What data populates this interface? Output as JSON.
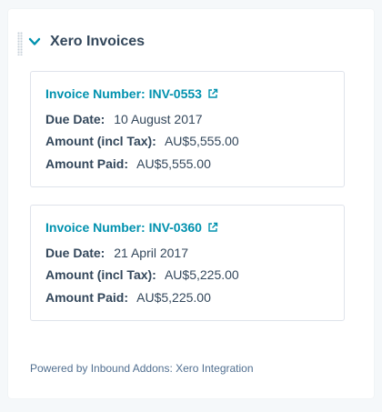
{
  "section": {
    "title": "Xero Invoices",
    "collapse_icon": "chevron-down-icon",
    "drag_icon": "drag-handle-icon"
  },
  "invoices": [
    {
      "link_label": "Invoice Number: INV-0553",
      "due_date_label": "Due Date:",
      "due_date": "10 August 2017",
      "amount_label": "Amount (incl Tax):",
      "amount": "AU$5,555.00",
      "paid_label": "Amount Paid:",
      "paid": "AU$5,555.00"
    },
    {
      "link_label": "Invoice Number: INV-0360",
      "due_date_label": "Due Date:",
      "due_date": "21 April 2017",
      "amount_label": "Amount (incl Tax):",
      "amount": "AU$5,225.00",
      "paid_label": "Amount Paid:",
      "paid": "AU$5,225.00"
    }
  ],
  "footer": {
    "text": "Powered by Inbound Addons: Xero Integration"
  },
  "colors": {
    "accent": "#0091ae",
    "text": "#33475b",
    "muted": "#516f90",
    "border": "#dfe3eb"
  }
}
